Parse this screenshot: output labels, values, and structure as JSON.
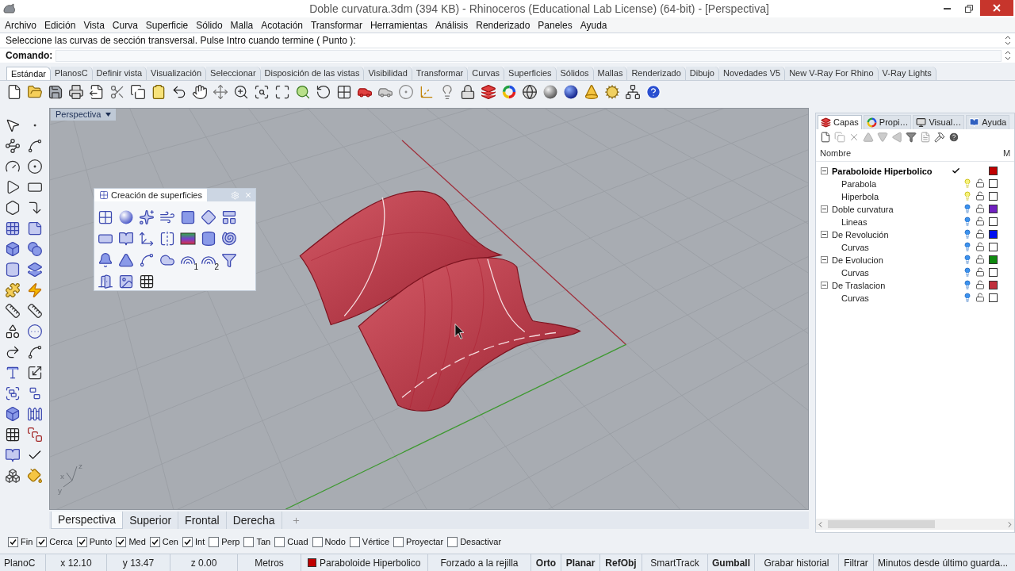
{
  "window": {
    "title": "Doble curvatura.3dm (394 KB) - Rhinoceros (Educational Lab License) (64-bit) - [Perspectiva]"
  },
  "menu": [
    "Archivo",
    "Edición",
    "Vista",
    "Curva",
    "Superficie",
    "Sólido",
    "Malla",
    "Acotación",
    "Transformar",
    "Herramientas",
    "Análisis",
    "Renderizado",
    "Paneles",
    "Ayuda"
  ],
  "command": {
    "history": "Seleccione las curvas de sección transversal. Pulse Intro cuando termine ( Punto ):",
    "prompt": "Comando:"
  },
  "toolbar_tabs": [
    {
      "label": "Estándar",
      "selected": true
    },
    {
      "label": "PlanosC",
      "selected": false
    },
    {
      "label": "Definir vista",
      "selected": false
    },
    {
      "label": "Visualización",
      "selected": false
    },
    {
      "label": "Seleccionar",
      "selected": false
    },
    {
      "label": "Disposición de las vistas",
      "selected": false
    },
    {
      "label": "Visibilidad",
      "selected": false
    },
    {
      "label": "Transformar",
      "selected": false
    },
    {
      "label": "Curvas",
      "selected": false
    },
    {
      "label": "Superficies",
      "selected": false
    },
    {
      "label": "Sólidos",
      "selected": false
    },
    {
      "label": "Mallas",
      "selected": false
    },
    {
      "label": "Renderizado",
      "selected": false
    },
    {
      "label": "Dibujo",
      "selected": false
    },
    {
      "label": "Novedades V5",
      "selected": false
    },
    {
      "label": "New V-Ray For Rhino",
      "selected": false
    },
    {
      "label": "V-Ray Lights",
      "selected": false
    }
  ],
  "viewport": {
    "label": "Perspectiva",
    "axis_labels": [
      "x",
      "y",
      "z"
    ],
    "floating_toolbar": {
      "title": "Creación de superficies",
      "rail_labels": [
        "1",
        "2"
      ]
    }
  },
  "layers_panel": {
    "tabs": [
      {
        "label": "Capas",
        "selected": true
      },
      {
        "label": "Propi…",
        "selected": false
      },
      {
        "label": "Visual…",
        "selected": false
      },
      {
        "label": "Ayuda",
        "selected": false
      }
    ],
    "columns": [
      "Nombre",
      "M"
    ],
    "layers": [
      {
        "name": "Paraboloide Hiperbolico",
        "current": true,
        "expanded": true,
        "color": "#c00000",
        "children": [
          {
            "name": "Parabola",
            "current": false,
            "lit": true,
            "locked": false,
            "color": "#ffffff"
          },
          {
            "name": "Hiperbola",
            "current": false,
            "lit": true,
            "locked": false,
            "color": "#ffffff"
          }
        ]
      },
      {
        "name": "Doble curvatura",
        "current": false,
        "lit": false,
        "locked": false,
        "expanded": true,
        "color": "#7020c0",
        "children": [
          {
            "name": "Lineas",
            "current": false,
            "lit": false,
            "locked": false,
            "color": "#ffffff"
          }
        ]
      },
      {
        "name": "De Revolución",
        "current": false,
        "lit": false,
        "locked": false,
        "expanded": true,
        "color": "#0010f0",
        "children": [
          {
            "name": "Curvas",
            "current": false,
            "lit": false,
            "locked": false,
            "color": "#ffffff"
          }
        ]
      },
      {
        "name": "De Evolucion",
        "current": false,
        "lit": false,
        "locked": false,
        "expanded": true,
        "color": "#108a10",
        "children": [
          {
            "name": "Curvas",
            "current": false,
            "lit": false,
            "locked": false,
            "color": "#ffffff"
          }
        ]
      },
      {
        "name": "De Traslacion",
        "current": false,
        "lit": false,
        "locked": false,
        "expanded": true,
        "color": "#c0303c",
        "children": [
          {
            "name": "Curvas",
            "current": false,
            "lit": false,
            "locked": false,
            "color": "#ffffff"
          }
        ]
      }
    ]
  },
  "viewport_tabs": [
    {
      "label": "Perspectiva",
      "selected": true
    },
    {
      "label": "Superior",
      "selected": false
    },
    {
      "label": "Frontal",
      "selected": false
    },
    {
      "label": "Derecha",
      "selected": false
    }
  ],
  "osnaps": [
    {
      "label": "Fin",
      "checked": true
    },
    {
      "label": "Cerca",
      "checked": true
    },
    {
      "label": "Punto",
      "checked": true
    },
    {
      "label": "Med",
      "checked": true
    },
    {
      "label": "Cen",
      "checked": true
    },
    {
      "label": "Int",
      "checked": true
    },
    {
      "label": "Perp",
      "checked": false
    },
    {
      "label": "Tan",
      "checked": false
    },
    {
      "label": "Cuad",
      "checked": false
    },
    {
      "label": "Nodo",
      "checked": false
    },
    {
      "label": "Vértice",
      "checked": false
    },
    {
      "label": "Proyectar",
      "checked": false
    },
    {
      "label": "Desactivar",
      "checked": false
    }
  ],
  "status_bar": {
    "cplane": "PlanoC",
    "x": "x 12.10",
    "y": "y 13.47",
    "z": "z 0.00",
    "units": "Metros",
    "layer": {
      "name": "Paraboloide Hiperbolico",
      "color": "#c00000"
    },
    "toggles": [
      {
        "label": "Forzado a la rejilla",
        "on": false
      },
      {
        "label": "Orto",
        "on": true
      },
      {
        "label": "Planar",
        "on": true
      },
      {
        "label": "RefObj",
        "on": true
      },
      {
        "label": "SmartTrack",
        "on": false
      },
      {
        "label": "Gumball",
        "on": true
      },
      {
        "label": "Grabar historial",
        "on": false
      },
      {
        "label": "Filtrar",
        "on": false
      }
    ],
    "message": "Minutos desde último guarda..."
  }
}
